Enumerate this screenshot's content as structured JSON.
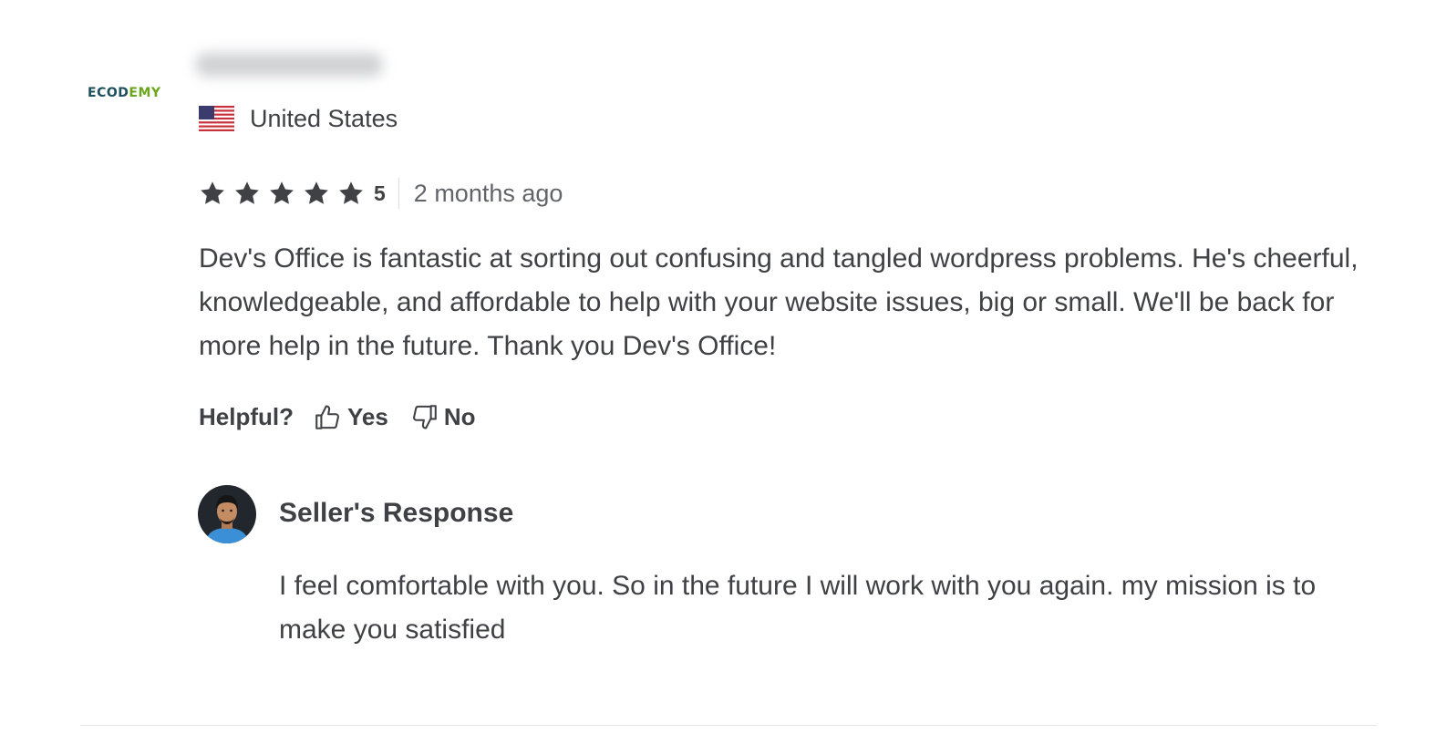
{
  "reviewer": {
    "logo_part1": "ECOD",
    "logo_part2": "EMY",
    "country": "United States"
  },
  "rating": {
    "stars": 5,
    "value": "5",
    "time_ago": "2 months ago"
  },
  "review": {
    "text": "Dev's Office is fantastic at sorting out confusing and tangled wordpress problems. He's cheerful, knowledgeable, and affordable to help with your website issues, big or small. We'll be back for more help in the future. Thank you Dev's Office!"
  },
  "helpful": {
    "label": "Helpful?",
    "yes_label": "Yes",
    "no_label": "No"
  },
  "seller_response": {
    "title": "Seller's Response",
    "text": "I feel comfortable with you. So in the future I will work with you again. my mission is to make you satisfied"
  },
  "icons": {
    "star": "star-icon",
    "thumbs_up": "thumbs-up-icon",
    "thumbs_down": "thumbs-down-icon",
    "flag": "us-flag-icon"
  },
  "colors": {
    "text": "#404145",
    "star": "#404145",
    "muted": "#62646a",
    "logo_primary": "#1d4f5c",
    "logo_accent": "#6aa61b"
  }
}
